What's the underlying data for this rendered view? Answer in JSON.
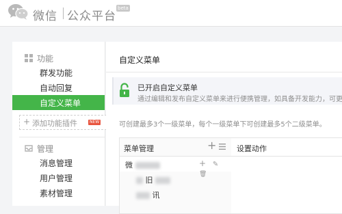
{
  "header": {
    "brand_name": "微信",
    "brand_platform": "公众平台",
    "beta_label": "beta"
  },
  "sidebar": {
    "function_section": {
      "label": "功能",
      "items": [
        {
          "label": "群发功能"
        },
        {
          "label": "自动回复"
        },
        {
          "label": "自定义菜单",
          "active": true
        }
      ],
      "add_plugin_label": "添加功能插件",
      "new_badge": "NEW"
    },
    "manage_section": {
      "label": "管理",
      "items": [
        {
          "label": "消息管理"
        },
        {
          "label": "用户管理"
        },
        {
          "label": "素材管理"
        }
      ]
    }
  },
  "main": {
    "page_title": "自定义菜单",
    "notice": {
      "title": "已开启自定义菜单",
      "description": "通过编辑和发布自定义菜单来进行便携管理，如具备开发能力，可更灵活"
    },
    "hint": "可创建最多3个一级菜单，每个一级菜单下可创建最多5个二级菜单。",
    "menu_manager": {
      "title": "菜单管理",
      "rows": [
        {
          "label": "微",
          "add": "+",
          "edit": "✎",
          "delete": "🗑"
        },
        {
          "label": "旧"
        },
        {
          "label": "讯"
        }
      ]
    },
    "settings": {
      "title": "设置动作"
    }
  },
  "colors": {
    "accent": "#44b549",
    "background": "#f3f4f6",
    "notice_bg": "#f4f5f9"
  }
}
